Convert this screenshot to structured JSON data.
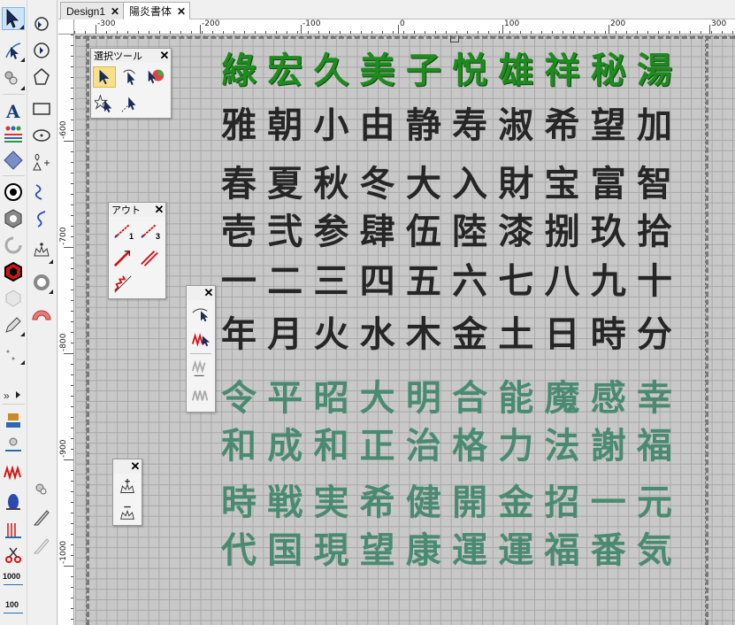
{
  "tabs": [
    {
      "label": "Design1",
      "close": "✕"
    },
    {
      "label": "陽炎書体",
      "close": "✕"
    }
  ],
  "ruler": {
    "top_labels": [
      "-300",
      "-200",
      "-100",
      "0",
      "100",
      "200",
      "300"
    ],
    "left_labels": [
      "-600",
      "-700",
      "-800",
      "-900",
      "-1000"
    ]
  },
  "panels": {
    "select_tool": {
      "title": "選択ツール",
      "close": "✕"
    },
    "outline": {
      "title": "アウト",
      "close": "✕",
      "label1": "1",
      "label3": "3"
    },
    "stitch": {
      "close": "✕"
    },
    "zoom": {
      "close": "✕"
    }
  },
  "toolbar": {
    "zoom_1000": "1000",
    "zoom_100": "100",
    "expand": "»"
  },
  "glyph_rows": [
    {
      "style": "green",
      "chars": [
        "綠",
        "宏",
        "久",
        "美",
        "子",
        "悦",
        "雄",
        "祥",
        "秘",
        "湯"
      ]
    },
    {
      "style": "black",
      "chars": [
        "雅",
        "朝",
        "小",
        "由",
        "静",
        "寿",
        "淑",
        "希",
        "望",
        "加"
      ]
    },
    {
      "style": "black",
      "chars": [
        "春",
        "夏",
        "秋",
        "冬",
        "大",
        "入",
        "財",
        "宝",
        "富",
        "智"
      ]
    },
    {
      "style": "black",
      "chars": [
        "壱",
        "弐",
        "参",
        "肆",
        "伍",
        "陸",
        "漆",
        "捌",
        "玖",
        "拾"
      ]
    },
    {
      "style": "black",
      "chars": [
        "一",
        "二",
        "三",
        "四",
        "五",
        "六",
        "七",
        "八",
        "九",
        "十"
      ]
    },
    {
      "style": "black",
      "chars": [
        "年",
        "月",
        "火",
        "水",
        "木",
        "金",
        "土",
        "日",
        "時",
        "分"
      ]
    },
    {
      "style": "teal",
      "chars": [
        "令",
        "平",
        "昭",
        "大",
        "明",
        "合",
        "能",
        "魔",
        "感",
        "幸"
      ]
    },
    {
      "style": "teal",
      "chars": [
        "和",
        "成",
        "和",
        "正",
        "治",
        "格",
        "力",
        "法",
        "謝",
        "福"
      ]
    },
    {
      "style": "teal",
      "chars": [
        "時",
        "戦",
        "実",
        "希",
        "健",
        "開",
        "金",
        "招",
        "一",
        "元"
      ]
    },
    {
      "style": "teal",
      "chars": [
        "代",
        "国",
        "現",
        "望",
        "康",
        "運",
        "運",
        "福",
        "番",
        "気"
      ]
    }
  ],
  "colors": {
    "green": "#1f8a1f",
    "black": "#262626",
    "teal": "#4a8a72",
    "select_highlight": "#f7e08a"
  }
}
